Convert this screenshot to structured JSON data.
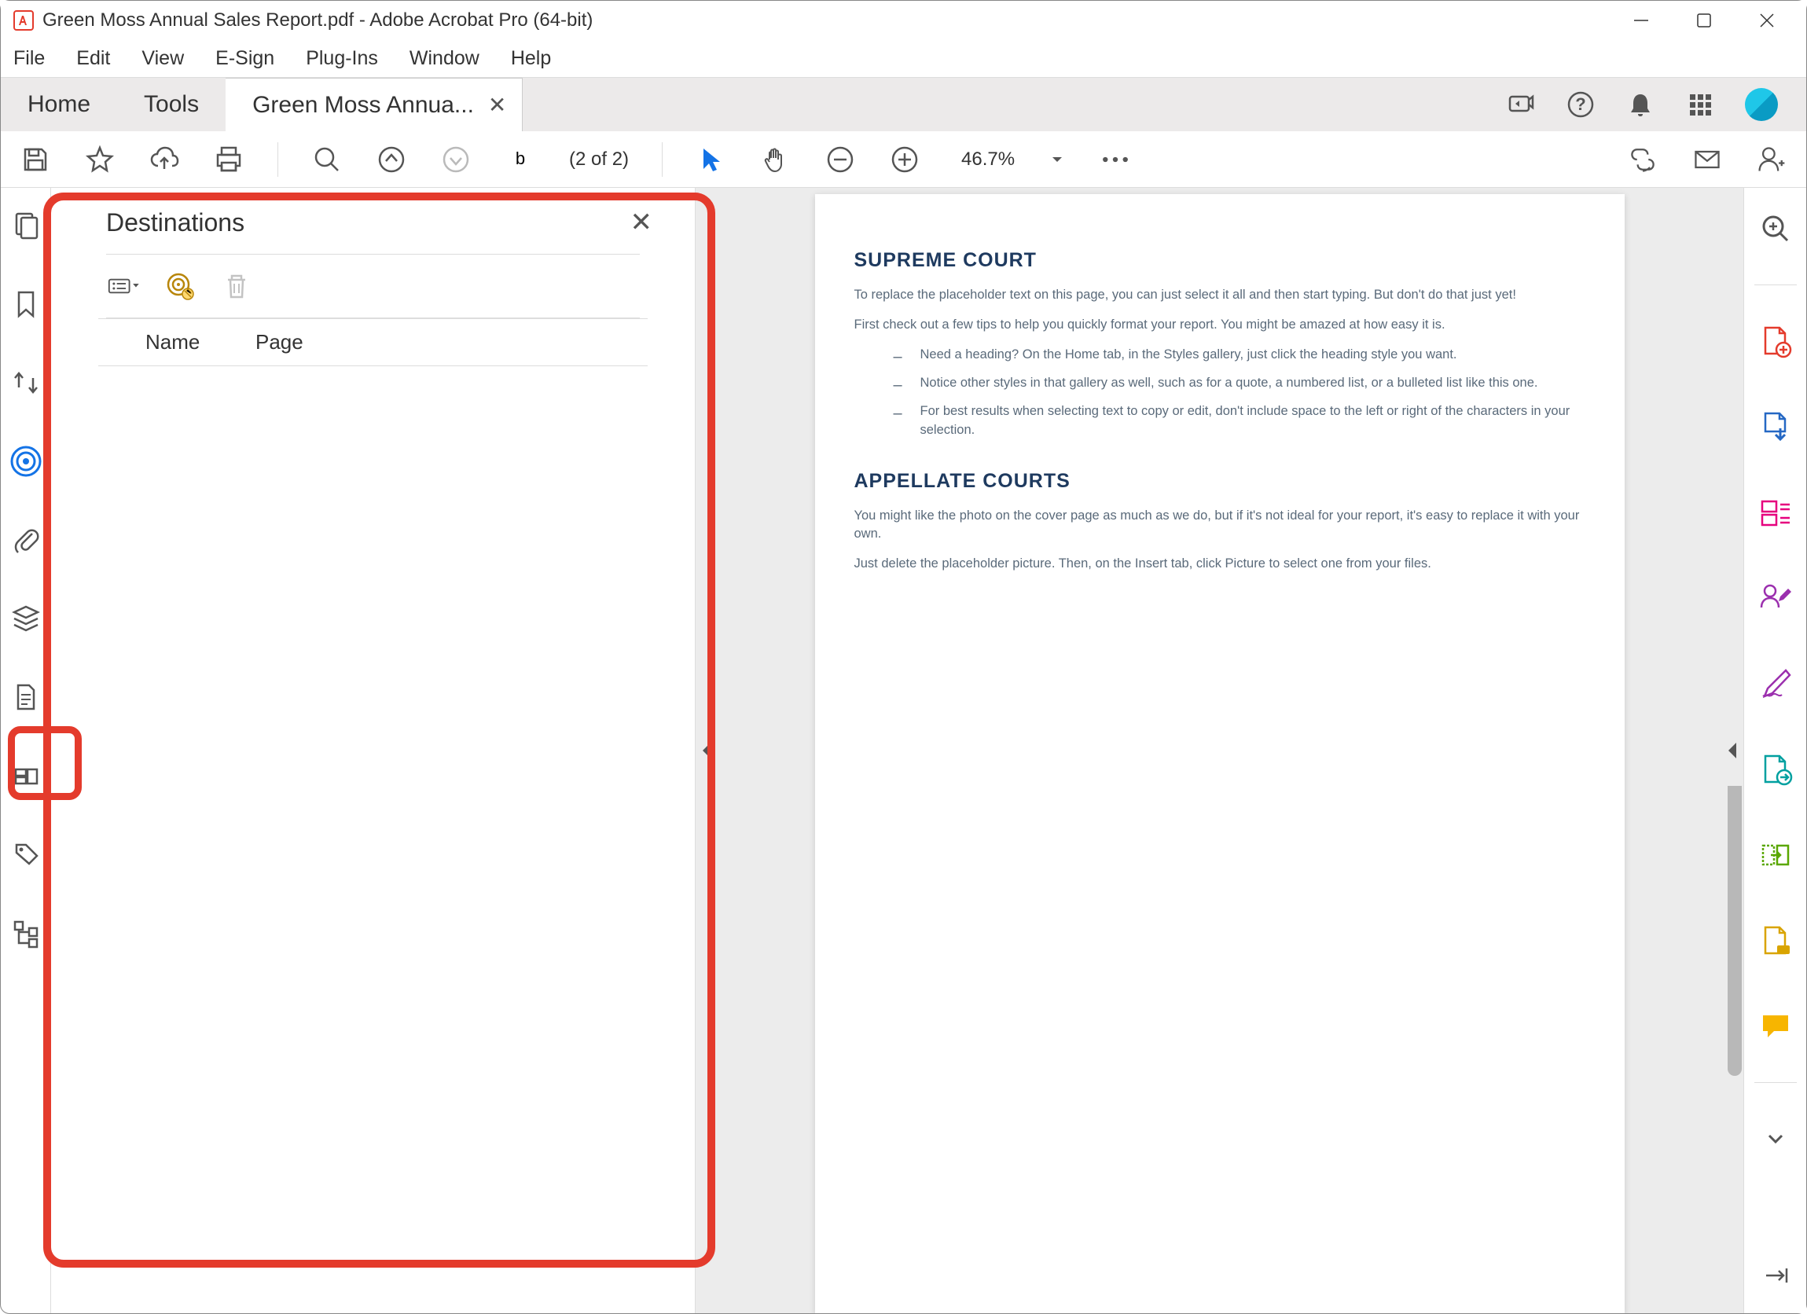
{
  "titlebar": {
    "title": "Green Moss Annual Sales Report.pdf - Adobe Acrobat Pro (64-bit)"
  },
  "menubar": {
    "file": "File",
    "edit": "Edit",
    "view": "View",
    "esign": "E-Sign",
    "plugins": "Plug-Ins",
    "window": "Window",
    "help": "Help"
  },
  "tabs": {
    "home": "Home",
    "tools": "Tools",
    "doc": "Green Moss Annua..."
  },
  "toolbar": {
    "page_input": "b",
    "page_count": "(2 of 2)",
    "zoom": "46.7%"
  },
  "nav_panel": {
    "title": "Destinations",
    "col_name": "Name",
    "col_page": "Page"
  },
  "document": {
    "h1": "SUPREME COURT",
    "p1": "To replace the placeholder text on this page, you can just select it all and then start typing. But don't do that just yet!",
    "p2": "First check out a few tips to help you quickly format your report. You might be amazed at how easy it is.",
    "li1": "Need a heading? On the Home tab, in the Styles gallery, just click the heading style you want.",
    "li2": "Notice other styles in that gallery as well, such as for a quote, a numbered list, or a bulleted list like this one.",
    "li3": "For best results when selecting text to copy or edit, don't include space to the left or right of the characters in your selection.",
    "h2": "APPELLATE COURTS",
    "p3": "You might like the photo on the cover page as much as we do, but if it's not ideal for your report, it's easy to replace it with your own.",
    "p4": "Just delete the placeholder picture. Then, on the Insert tab, click Picture to select one from your files."
  }
}
